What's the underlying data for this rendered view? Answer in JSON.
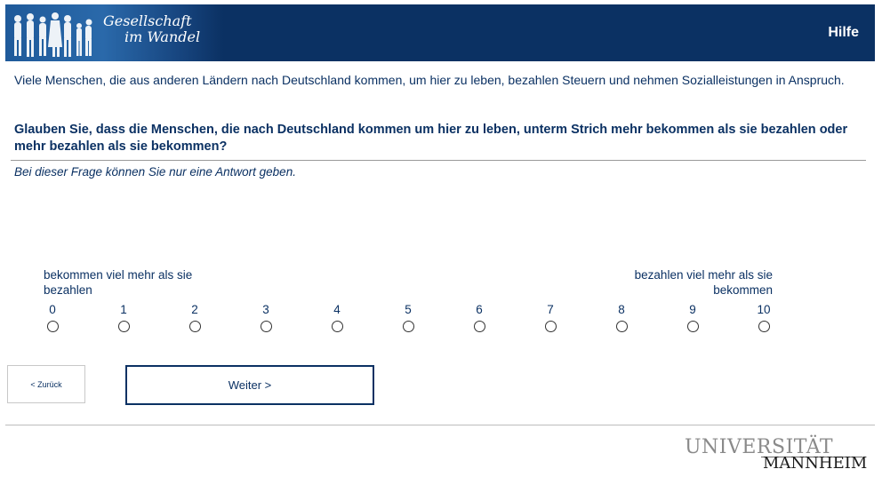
{
  "header": {
    "title_line1": "Gesellschaft",
    "title_line2": "im Wandel",
    "help_label": "Hilfe",
    "background_color": "#0b3163"
  },
  "intro_text": "Viele Menschen, die aus anderen Ländern nach Deutschland kommen, um hier zu leben, bezahlen Steuern und nehmen Sozialleistungen in Anspruch.",
  "question_text": "Glauben Sie, dass die Menschen, die nach Deutschland kommen um hier zu leben, unterm Strich mehr bekommen als sie bezahlen oder mehr bezahlen als sie bekommen?",
  "instruction_text": "Bei dieser Frage können Sie nur eine Antwort geben.",
  "scale": {
    "left_label": "bekommen viel mehr als sie bezahlen",
    "right_label": "bezahlen viel mehr als sie bekommen",
    "options": [
      "0",
      "1",
      "2",
      "3",
      "4",
      "5",
      "6",
      "7",
      "8",
      "9",
      "10"
    ],
    "selected": null
  },
  "navigation": {
    "back_label": "< Zurück",
    "next_label": "Weiter >"
  },
  "footer": {
    "logo_line1": "UNIVERSITÄT",
    "logo_line2": "MANNHEIM"
  }
}
